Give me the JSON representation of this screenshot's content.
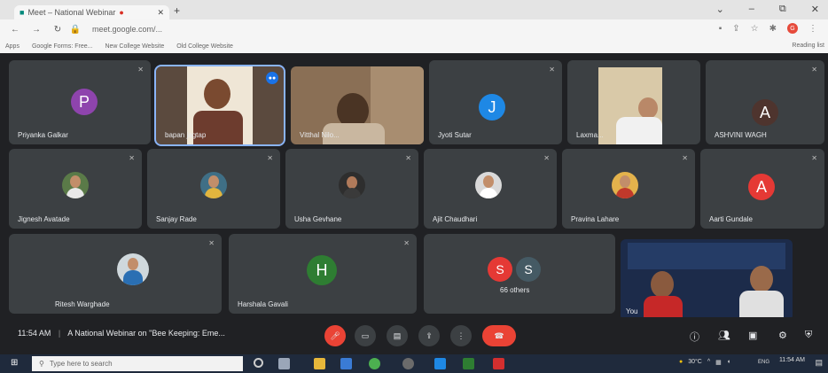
{
  "browser": {
    "tab_title": "Meet – National Webinar",
    "url": "meet.google.com/...",
    "bookmarks": [
      "Apps",
      "Google Forms: Free...",
      "New College Website",
      "Old College Website"
    ],
    "bookmarks_right": "Reading list",
    "window_controls": [
      "⌄",
      "–",
      "⧉",
      "✕"
    ]
  },
  "tiles": [
    {
      "name": "Priyanka Galkar",
      "kind": "avatar",
      "initial": "P",
      "color": "#8e44ad"
    },
    {
      "name": "bapan jagtap",
      "kind": "video"
    },
    {
      "name": "Vitthal Nilo...",
      "kind": "video"
    },
    {
      "name": "Jyoti Sutar",
      "kind": "avatar",
      "initial": "J",
      "color": "#1e88e5"
    },
    {
      "name": "Laxma...",
      "kind": "video"
    },
    {
      "name": "ASHVINI WAGH",
      "kind": "avatar",
      "initial": "A",
      "color": "#4e342e"
    },
    {
      "name": "Jignesh Avatade",
      "kind": "photo"
    },
    {
      "name": "Sanjay Rade",
      "kind": "photo"
    },
    {
      "name": "Usha Gevhane",
      "kind": "photo"
    },
    {
      "name": "Ajit Chaudhari",
      "kind": "photo"
    },
    {
      "name": "Pravina Lahare",
      "kind": "photo"
    },
    {
      "name": "Aarti Gundale",
      "kind": "avatar",
      "initial": "A",
      "color": "#e53935"
    },
    {
      "name": "Ritesh Warghade",
      "kind": "photo"
    },
    {
      "name": "Harshala Gavali",
      "kind": "avatar",
      "initial": "H",
      "color": "#2e7d32"
    },
    {
      "name": "66 others",
      "kind": "others",
      "initials": [
        "S",
        "S"
      ]
    },
    {
      "name": "You",
      "kind": "self"
    }
  ],
  "controls": {
    "time": "11:54 AM",
    "meeting_title": "A National Webinar on \"Bee Keeping: Eme..."
  },
  "taskbar": {
    "search_placeholder": "Type here to search",
    "weather": "30°C",
    "lang": "ENG",
    "clock_time": "11:54 AM"
  },
  "colors": {
    "meet_bg": "#202124",
    "tile_bg": "#3c4043",
    "accent_red": "#ea4335",
    "active_outline": "#8ab4f8"
  }
}
